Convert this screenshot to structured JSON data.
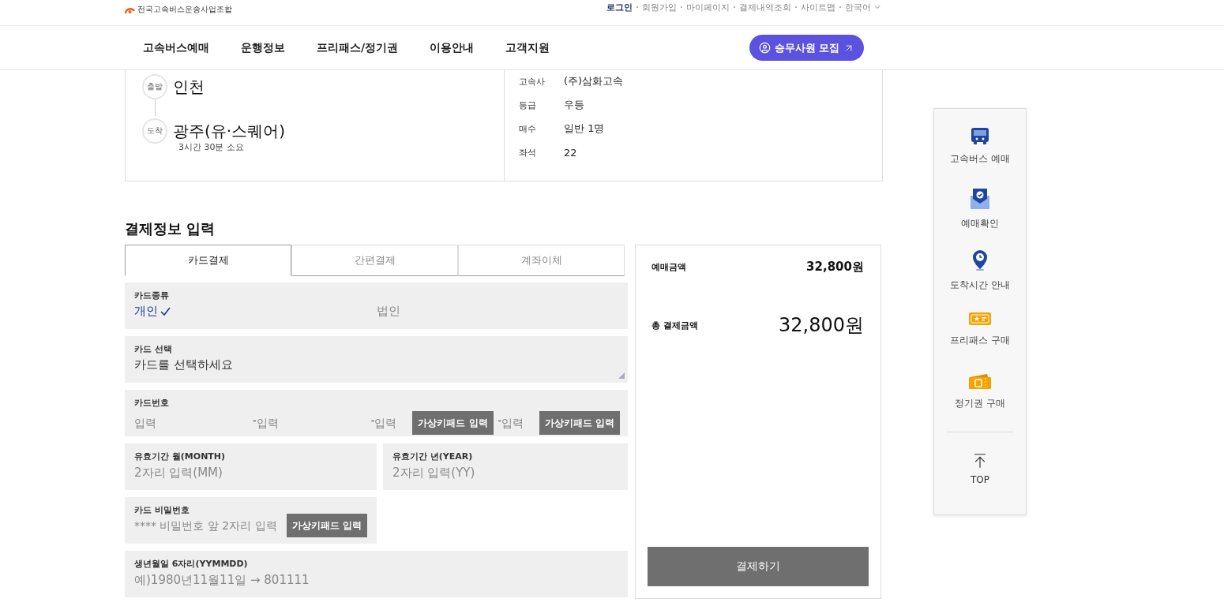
{
  "header": {
    "org_name": "전국고속버스운송사업조합",
    "util_links": [
      {
        "label": "로그인",
        "current": true
      },
      {
        "label": "회원가입",
        "current": false
      },
      {
        "label": "마이페이지",
        "current": false
      },
      {
        "label": "결제내역조회",
        "current": false
      },
      {
        "label": "사이트맵",
        "current": false
      }
    ],
    "language": "한국어",
    "nav": [
      "고속버스예매",
      "운행정보",
      "프리패스/정기권",
      "이용안내",
      "고객지원"
    ],
    "recruit_button": "승무사원 모집"
  },
  "route": {
    "stops": [
      {
        "badge": "출발",
        "name": "인천"
      },
      {
        "badge": "도착",
        "name": "광주(유·스퀘어)",
        "note": "3시간 30분 소요"
      }
    ],
    "details": [
      {
        "label": "고속사",
        "value": "(주)삼화고속"
      },
      {
        "label": "등급",
        "value": "우등"
      },
      {
        "label": "매수",
        "value": "일반 1명"
      },
      {
        "label": "좌석",
        "value": "22"
      }
    ]
  },
  "payment": {
    "title": "결제정보 입력",
    "tabs": [
      {
        "label": "카드결제",
        "selected": true
      },
      {
        "label": "간편결제",
        "selected": false
      },
      {
        "label": "계좌이체",
        "selected": false
      }
    ],
    "fields": [
      {
        "kind": "choice",
        "label": "카드종류",
        "options": [
          {
            "label": "개인",
            "selected": true
          },
          {
            "label": "법인",
            "selected": false
          }
        ]
      },
      {
        "kind": "select",
        "label": "카드 선택",
        "value": "카드를 선택하세요"
      },
      {
        "kind": "card_number",
        "label": "카드번호",
        "segments": [
          {
            "placeholder": "입력"
          },
          {
            "separator": "-",
            "placeholder": "입력"
          },
          {
            "separator": "-",
            "placeholder": "입력",
            "keypad": "가상키패드 입력"
          },
          {
            "separator": "-",
            "placeholder": "입력",
            "keypad": "가상키패드 입력"
          }
        ]
      },
      {
        "kind": "half",
        "label": "유효기간 월(MONTH)",
        "placeholder": "2자리 입력(MM)"
      },
      {
        "kind": "half",
        "label": "유효기간 년(YEAR)",
        "placeholder": "2자리 입력(YY)"
      },
      {
        "kind": "half",
        "label": "카드 비밀번호",
        "placeholder": "**** 비밀번호 앞 2자리 입력",
        "keypad": "가상키패드 입력"
      },
      {
        "kind": "full",
        "label": "생년월일 6자리(YYMMDD)",
        "placeholder": "예)1980년11월11일 → 801111"
      }
    ]
  },
  "summary": {
    "fare_label": "예매금액",
    "fare": "32,800원",
    "total_label": "총 결제금액",
    "total": "32,800원",
    "pay_button": "결제하기"
  },
  "quick_menu": {
    "items": [
      {
        "kind": "bus",
        "label": "고속버스 예매"
      },
      {
        "kind": "mail",
        "label": "예매확인"
      },
      {
        "kind": "pin",
        "label": "도착시간 안내"
      },
      {
        "kind": "pass",
        "label": "프리패스 구매"
      },
      {
        "kind": "ticket",
        "label": "정기권 구매"
      }
    ],
    "top_label": "TOP"
  }
}
